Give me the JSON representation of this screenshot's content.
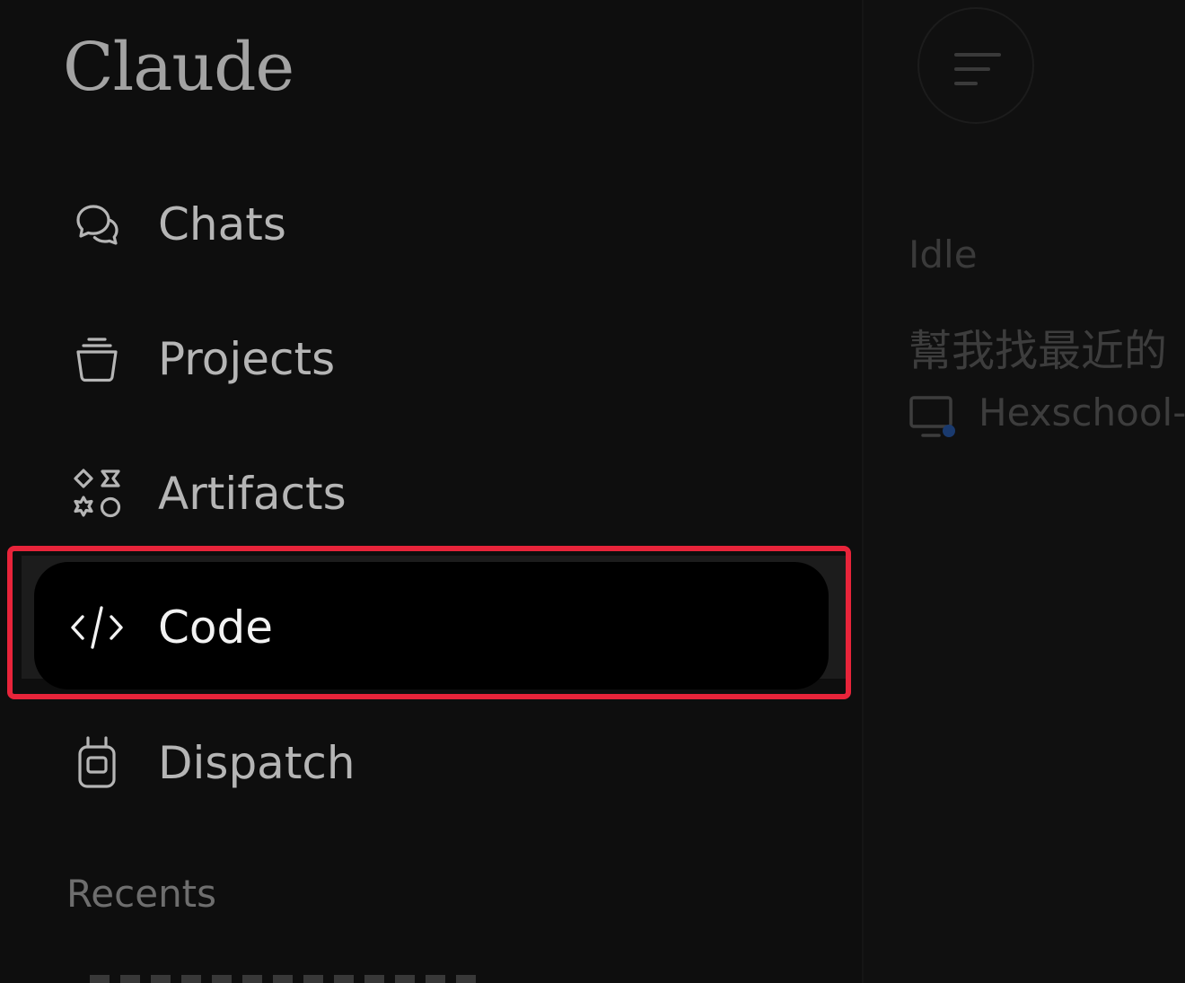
{
  "app": {
    "logo_text": "Claude"
  },
  "sidebar": {
    "items": [
      {
        "label": "Chats",
        "icon": "chats-icon",
        "active": false
      },
      {
        "label": "Projects",
        "icon": "projects-icon",
        "active": false
      },
      {
        "label": "Artifacts",
        "icon": "artifacts-icon",
        "active": false
      },
      {
        "label": "Code",
        "icon": "code-icon",
        "active": true
      },
      {
        "label": "Dispatch",
        "icon": "dispatch-icon",
        "active": false
      }
    ],
    "recents_heading": "Recents"
  },
  "main": {
    "menu_button_icon": "menu-lines-icon",
    "status": "Idle",
    "session_title": "幫我找最近的",
    "project_icon": "screen-icon",
    "project_name": "Hexschool-"
  },
  "colors": {
    "sidebar_bg": "#0e0e0e",
    "active_item_bg": "#000000",
    "highlight_border": "#e8243a",
    "label_text": "#b5b5b5",
    "active_label_text": "#f2f2f2",
    "status_dot": "#2f6fd0"
  }
}
